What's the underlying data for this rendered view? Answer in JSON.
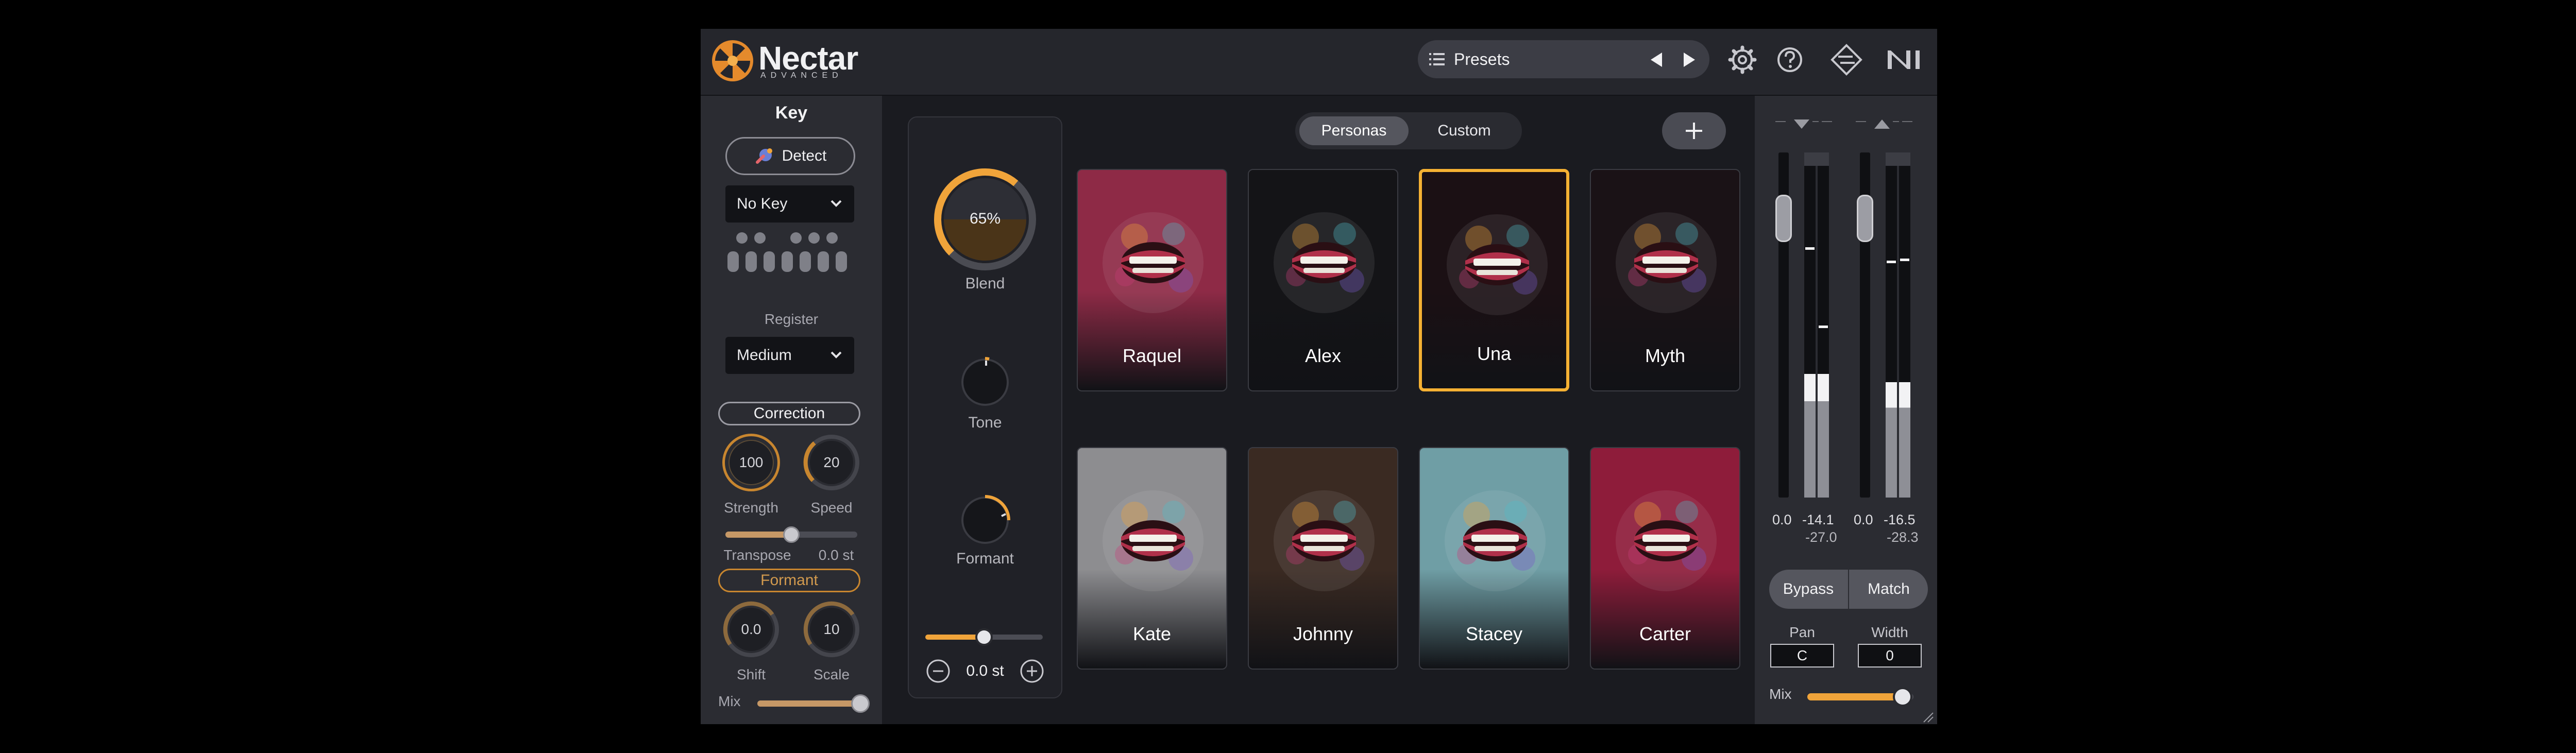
{
  "app": {
    "name": "Nectar",
    "edition": "ADVANCED"
  },
  "header": {
    "presets_label": "Presets"
  },
  "key_section": {
    "title": "Key",
    "detect_label": "Detect",
    "key_value": "No Key",
    "register_label": "Register",
    "register_value": "Medium"
  },
  "correction": {
    "title": "Correction",
    "strength": {
      "value": "100",
      "label": "Strength"
    },
    "speed": {
      "value": "20",
      "label": "Speed"
    },
    "transpose": {
      "label": "Transpose",
      "value": "0.0 st",
      "level": 0.5
    }
  },
  "formant": {
    "title": "Formant",
    "shift": {
      "value": "0.0",
      "label": "Shift"
    },
    "scale": {
      "value": "10",
      "label": "Scale"
    },
    "mix_label": "Mix",
    "mix_level": 1.0
  },
  "blend": {
    "blend_value": "65%",
    "blend_level": 0.65,
    "blend_label": "Blend",
    "tone_label": "Tone",
    "formant_label": "Formant",
    "pitch_value": "0.0 st",
    "pitch_level": 0.5
  },
  "tabs": [
    {
      "label": "Personas",
      "active": true
    },
    {
      "label": "Custom",
      "active": false
    }
  ],
  "personas": [
    {
      "name": "Raquel",
      "selected": false,
      "bg": "#8e2a46"
    },
    {
      "name": "Alex",
      "selected": false,
      "bg": "#141417"
    },
    {
      "name": "Una",
      "selected": true,
      "bg": "#1b1014"
    },
    {
      "name": "Myth",
      "selected": false,
      "bg": "#1a1216"
    },
    {
      "name": "Kate",
      "selected": false,
      "bg": "#8d8d90"
    },
    {
      "name": "Johnny",
      "selected": false,
      "bg": "#3a2a22"
    },
    {
      "name": "Stacey",
      "selected": false,
      "bg": "#6f9ea5"
    },
    {
      "name": "Carter",
      "selected": false,
      "bg": "#8e1c3a"
    }
  ],
  "meters": {
    "input": {
      "peak": "0.0",
      "rms": "-14.1",
      "rms2": "-27.0"
    },
    "output": {
      "peak": "0.0",
      "rms": "-16.5",
      "rms2": "-28.3"
    }
  },
  "output_controls": {
    "bypass_label": "Bypass",
    "match_label": "Match",
    "pan_label": "Pan",
    "pan_value": "C",
    "width_label": "Width",
    "width_value": "0",
    "mix_label": "Mix",
    "mix_level": 0.9
  },
  "colors": {
    "accent": "#f0a43a",
    "selected_border": "#f5b133"
  },
  "icons": [
    "logo-icon",
    "list-icon",
    "prev-arrow-icon",
    "next-arrow-icon",
    "gear-icon",
    "help-icon",
    "routing-icon",
    "ni-logo-icon",
    "detect-icon",
    "chevron-down-icon",
    "plus-icon",
    "minus-icon"
  ]
}
